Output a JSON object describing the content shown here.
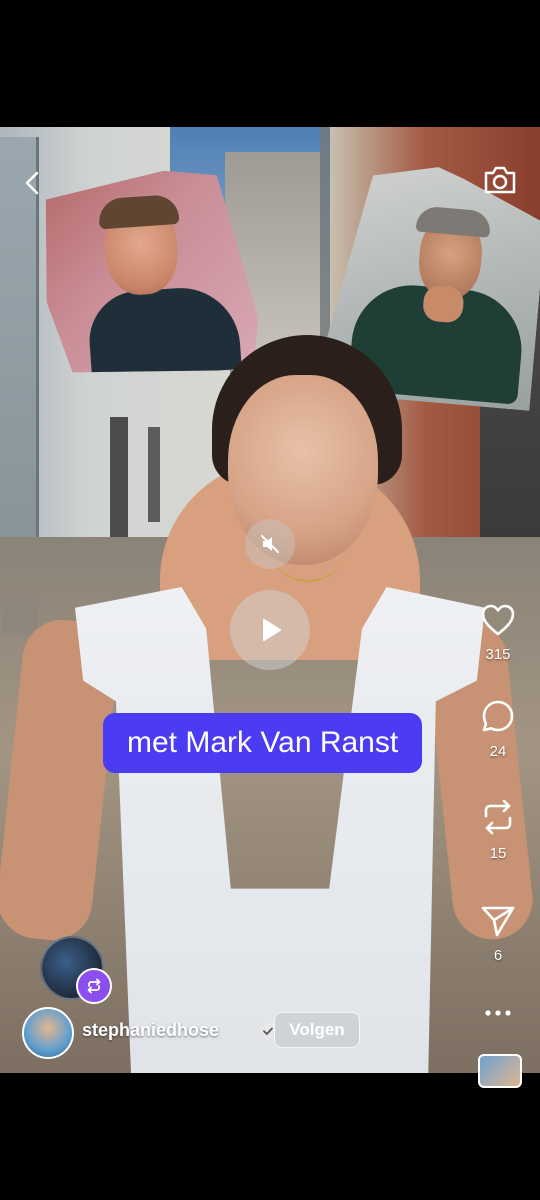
{
  "caption": {
    "text": "met Mark Van Ranst"
  },
  "actions": {
    "likes": "315",
    "comments": "24",
    "reposts": "15",
    "shares": "6"
  },
  "user": {
    "username": "stephaniedhose",
    "follow_label": "Volgen"
  },
  "icons": {
    "back": "back-arrow-icon",
    "camera": "camera-icon",
    "mute": "muted-speaker-icon",
    "play": "play-icon",
    "like": "heart-icon",
    "comment": "comment-bubble-icon",
    "repost": "repost-icon",
    "share": "paper-plane-icon",
    "more": "more-dots-icon",
    "remix": "remix-icon",
    "verified": "verified-badge-icon"
  },
  "colors": {
    "caption_bg": "#4b3bf2",
    "remix_badge": "#8b4ff0"
  }
}
